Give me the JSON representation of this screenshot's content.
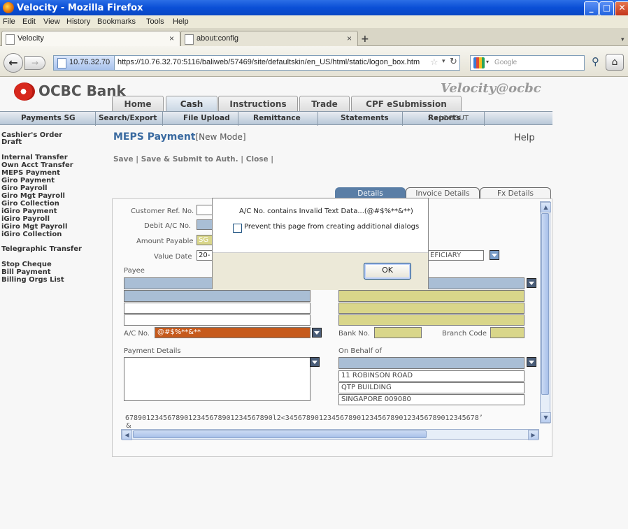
{
  "window": {
    "title": "Velocity - Mozilla Firefox"
  },
  "menubar": [
    "File",
    "Edit",
    "View",
    "History",
    "Bookmarks",
    "Tools",
    "Help"
  ],
  "browser_tabs": [
    {
      "label": "Velocity",
      "active": true
    },
    {
      "label": "about:config",
      "active": false
    }
  ],
  "nav": {
    "site_identity": "10.76.32.70",
    "url": "https://10.76.32.70:5116/baliweb/57469/site/defaultskin/en_US/html/static/logon_box.htm",
    "search_placeholder": "Google"
  },
  "header": {
    "logo": "OCBC Bank",
    "product_logo": "Velocity@ocbc",
    "main_tabs": [
      "Home",
      "Cash",
      "Instructions",
      "Trade",
      "CPF eSubmission"
    ],
    "logout": ">>LOGOUT"
  },
  "subnav": [
    "Payments SG",
    "Search/Export",
    "File Upload",
    "Remittance",
    "Statements",
    "Reports"
  ],
  "sidebar": {
    "group1": [
      "Cashier's Order",
      "Draft"
    ],
    "group2": [
      "Internal Transfer",
      "Own Acct Transfer",
      "MEPS Payment",
      "Giro Payment",
      "Giro Payroll",
      "Giro Mgt Payroll",
      "Giro Collection",
      "iGiro Payment",
      "iGiro Payroll",
      "iGiro Mgt Payroll",
      "iGiro Collection"
    ],
    "group3": [
      "Telegraphic Transfer"
    ],
    "group4": [
      "Stop Cheque",
      "Bill Payment",
      "Billing Orgs List"
    ]
  },
  "content": {
    "title": "MEPS Payment",
    "mode": "[New Mode]",
    "help": "Help",
    "actions": [
      "Save",
      "Save & Submit to Auth.",
      "Close"
    ],
    "tabs": [
      "Details",
      "Invoice Details",
      "Fx Details"
    ]
  },
  "form": {
    "customer_ref_label": "Customer Ref. No.",
    "debit_ac_label": "Debit A/C No.",
    "amount_payable_label": "Amount Payable",
    "amount_currency": "SG",
    "value_date_label": "Value Date",
    "value_date": "20-",
    "beneficiary_select": "EFICIARY",
    "payee_label": "Payee",
    "ac_no_label": "A/C No.",
    "ac_no_value": "@#$%**&**",
    "bank_no_label": "Bank No.",
    "branch_code_label": "Branch Code",
    "payment_details_label": "Payment Details",
    "on_behalf_label": "On Behalf of",
    "address": [
      "11 ROBINSON ROAD",
      "QTP BUILDING",
      "SINGAPORE 009080"
    ],
    "number_string": "67890123456789012345678901234567890l2<3456789012345678901234567890123456789012345678’",
    "number_string_wrap": "&"
  },
  "dialog": {
    "message": "A/C No. contains Invalid Text Data...(@#$%**&**)",
    "checkbox_label": "Prevent this page from creating additional dialogs",
    "ok": "OK"
  }
}
